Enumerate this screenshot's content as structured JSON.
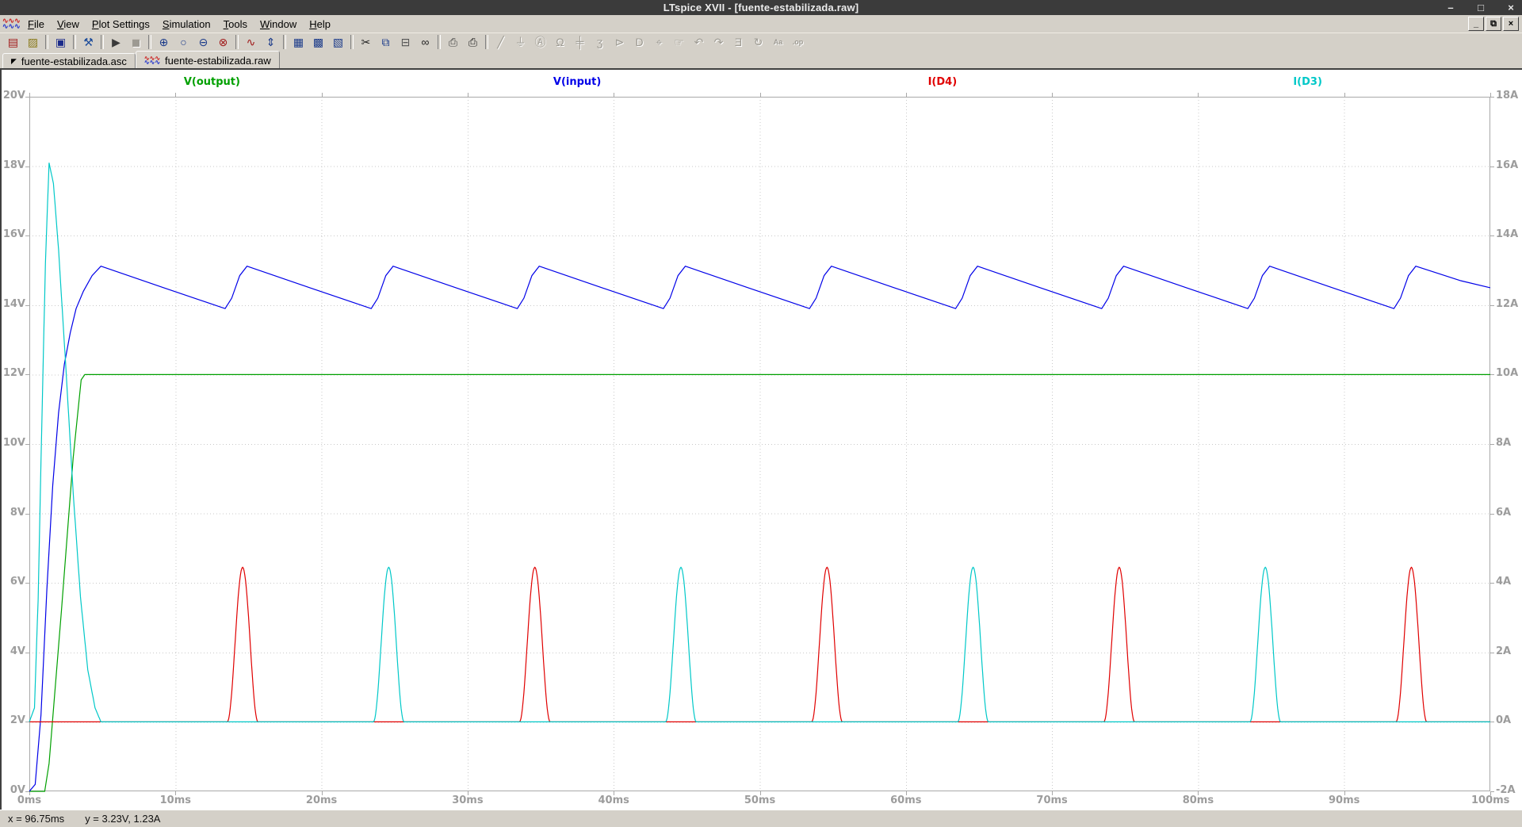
{
  "window": {
    "title": "LTspice XVII - [fuente-estabilizada.raw]",
    "controls": {
      "minimize": "–",
      "maximize": "□",
      "close": "×"
    }
  },
  "menubar": {
    "items": [
      {
        "label": "File"
      },
      {
        "label": "View"
      },
      {
        "label": "Plot Settings"
      },
      {
        "label": "Simulation"
      },
      {
        "label": "Tools"
      },
      {
        "label": "Window"
      },
      {
        "label": "Help"
      }
    ],
    "mdi_controls": {
      "minimize": "_",
      "restore": "⧉",
      "close": "×"
    },
    "app_icon_waves": {
      "top": "∿∿∿",
      "bottom": "∿∿∿"
    }
  },
  "toolbar": {
    "items": [
      {
        "name": "new-schematic",
        "glyph": "▤",
        "color": "#a01818",
        "enabled": true
      },
      {
        "name": "open-file",
        "glyph": "▨",
        "color": "#8a7a1a",
        "enabled": true
      },
      {
        "sep": true
      },
      {
        "name": "save",
        "glyph": "▣",
        "color": "#1a2a8a",
        "enabled": true
      },
      {
        "sep": true
      },
      {
        "name": "control-panel",
        "glyph": "⚒",
        "color": "#1a4a9a",
        "enabled": true
      },
      {
        "sep": true
      },
      {
        "name": "run-simulation",
        "glyph": "▶",
        "color": "#3a3a3a",
        "enabled": true
      },
      {
        "name": "halt-simulation",
        "glyph": "◼",
        "color": "#888888",
        "enabled": false
      },
      {
        "sep": true
      },
      {
        "name": "zoom-in",
        "glyph": "⊕",
        "color": "#1a3a8a",
        "enabled": true
      },
      {
        "name": "zoom-back",
        "glyph": "○",
        "color": "#1a3a8a",
        "enabled": true
      },
      {
        "name": "zoom-out",
        "glyph": "⊖",
        "color": "#1a3a8a",
        "enabled": true
      },
      {
        "name": "zoom-full-extents",
        "glyph": "⊗",
        "color": "#a01818",
        "enabled": true
      },
      {
        "sep": true
      },
      {
        "name": "plot-settings",
        "glyph": "∿",
        "color": "#a01818",
        "enabled": true
      },
      {
        "name": "autorange-axes",
        "glyph": "⇕",
        "color": "#1a3a8a",
        "enabled": true
      },
      {
        "sep": true
      },
      {
        "name": "tile-vertically",
        "glyph": "▦",
        "color": "#1a3a8a",
        "enabled": true
      },
      {
        "name": "tile-horizontally",
        "glyph": "▩",
        "color": "#1a3a8a",
        "enabled": true
      },
      {
        "name": "cascade-windows",
        "glyph": "▧",
        "color": "#1a3a8a",
        "enabled": true
      },
      {
        "sep": true
      },
      {
        "name": "cut",
        "glyph": "✂",
        "color": "#222222",
        "enabled": true
      },
      {
        "name": "copy",
        "glyph": "⧉",
        "color": "#1a3a8a",
        "enabled": true
      },
      {
        "name": "paste",
        "glyph": "⊟",
        "color": "#555555",
        "enabled": true
      },
      {
        "name": "find",
        "glyph": "∞",
        "color": "#222222",
        "enabled": true
      },
      {
        "sep": true
      },
      {
        "name": "print-preview",
        "glyph": "⎙",
        "color": "#444444",
        "enabled": true
      },
      {
        "name": "print",
        "glyph": "⎙",
        "color": "#222222",
        "enabled": true
      },
      {
        "sep": true
      },
      {
        "name": "draw-wire",
        "glyph": "╱",
        "color": "#444444",
        "enabled": false
      },
      {
        "name": "place-ground",
        "glyph": "⏚",
        "color": "#444444",
        "enabled": false
      },
      {
        "name": "place-label",
        "glyph": "Ⓐ",
        "color": "#444444",
        "enabled": false
      },
      {
        "name": "place-resistor",
        "glyph": "Ω",
        "color": "#444444",
        "enabled": false
      },
      {
        "name": "place-capacitor",
        "glyph": "╪",
        "color": "#444444",
        "enabled": false
      },
      {
        "name": "place-inductor",
        "glyph": "ʒ",
        "color": "#444444",
        "enabled": false
      },
      {
        "name": "place-diode",
        "glyph": "⊳",
        "color": "#444444",
        "enabled": false
      },
      {
        "name": "place-component",
        "glyph": "D",
        "color": "#444444",
        "enabled": false
      },
      {
        "name": "move",
        "glyph": "⌖",
        "color": "#444444",
        "enabled": false
      },
      {
        "name": "drag",
        "glyph": "☞",
        "color": "#444444",
        "enabled": false
      },
      {
        "name": "undo",
        "glyph": "↶",
        "color": "#444444",
        "enabled": false
      },
      {
        "name": "redo",
        "glyph": "↷",
        "color": "#444444",
        "enabled": false
      },
      {
        "name": "mirror",
        "glyph": "Ǝ",
        "color": "#444444",
        "enabled": false
      },
      {
        "name": "rotate",
        "glyph": "↻",
        "color": "#444444",
        "enabled": false
      },
      {
        "name": "add-text",
        "glyph": "Aa",
        "color": "#444444",
        "enabled": false,
        "small": true
      },
      {
        "name": "spice-directive",
        "glyph": ".op",
        "color": "#444444",
        "enabled": false,
        "small": true
      }
    ]
  },
  "tabs": [
    {
      "label": "fuente-estabilizada.asc",
      "active": false
    },
    {
      "label": "fuente-estabilizada.raw",
      "active": true
    }
  ],
  "statusbar": {
    "x_readout": "x = 96.75ms",
    "y_readout": "y = 3.23V, 1.23A"
  },
  "chart_data": {
    "type": "line",
    "background": "#ffffff",
    "grid": true,
    "grid_color": "#c9c9c9",
    "axis_color": "#a8a8a8",
    "label_color": "#9c9c9c",
    "legend_position": "top-spread",
    "x": {
      "unit": "ms",
      "min": 0,
      "max": 100,
      "tick": 10,
      "tick_labels": [
        "0ms",
        "10ms",
        "20ms",
        "30ms",
        "40ms",
        "50ms",
        "60ms",
        "70ms",
        "80ms",
        "90ms",
        "100ms"
      ]
    },
    "y_left": {
      "unit": "V",
      "min": 0,
      "max": 20,
      "tick": 2,
      "tick_labels": [
        "20V",
        "18V",
        "16V",
        "14V",
        "12V",
        "10V",
        "8V",
        "6V",
        "4V",
        "2V",
        "0V"
      ]
    },
    "y_right": {
      "unit": "A",
      "min": -2,
      "max": 18,
      "tick": 2,
      "tick_labels": [
        "18A",
        "16A",
        "14A",
        "12A",
        "10A",
        "8A",
        "6A",
        "4A",
        "2A",
        "0A",
        "-2A"
      ]
    },
    "series": [
      {
        "name": "V(output)",
        "color": "#00a000",
        "axis": "y_left",
        "points": [
          [
            0,
            0
          ],
          [
            1.05,
            0
          ],
          [
            1.35,
            0.8
          ],
          [
            2.2,
            5.2
          ],
          [
            3.0,
            9.6
          ],
          [
            3.55,
            11.85
          ],
          [
            3.8,
            12
          ],
          [
            100,
            12
          ]
        ]
      },
      {
        "name": "V(input)",
        "color": "#0000e8",
        "axis": "y_left",
        "points": [
          [
            0,
            0
          ],
          [
            0.4,
            0.2
          ],
          [
            0.8,
            2.2
          ],
          [
            1.2,
            5.8
          ],
          [
            1.6,
            8.8
          ],
          [
            2,
            10.9
          ],
          [
            2.4,
            12.3
          ],
          [
            2.8,
            13.2
          ],
          [
            3.2,
            13.9
          ],
          [
            3.7,
            14.4
          ],
          [
            4.3,
            14.85
          ],
          [
            4.9,
            15.12
          ],
          [
            9.2,
            14.5
          ],
          [
            13.4,
            13.9
          ],
          [
            13.85,
            14.2
          ],
          [
            14.4,
            14.85
          ],
          [
            14.9,
            15.12
          ],
          [
            19.2,
            14.5
          ],
          [
            23.4,
            13.9
          ],
          [
            23.85,
            14.2
          ],
          [
            24.4,
            14.85
          ],
          [
            24.9,
            15.12
          ],
          [
            29.2,
            14.5
          ],
          [
            33.4,
            13.9
          ],
          [
            33.85,
            14.2
          ],
          [
            34.4,
            14.85
          ],
          [
            34.9,
            15.12
          ],
          [
            39.2,
            14.5
          ],
          [
            43.4,
            13.9
          ],
          [
            43.85,
            14.2
          ],
          [
            44.4,
            14.85
          ],
          [
            44.9,
            15.12
          ],
          [
            49.2,
            14.5
          ],
          [
            53.4,
            13.9
          ],
          [
            53.85,
            14.2
          ],
          [
            54.4,
            14.85
          ],
          [
            54.9,
            15.12
          ],
          [
            59.2,
            14.5
          ],
          [
            63.4,
            13.9
          ],
          [
            63.85,
            14.2
          ],
          [
            64.4,
            14.85
          ],
          [
            64.9,
            15.12
          ],
          [
            69.2,
            14.5
          ],
          [
            73.4,
            13.9
          ],
          [
            73.85,
            14.2
          ],
          [
            74.4,
            14.85
          ],
          [
            74.9,
            15.12
          ],
          [
            79.2,
            14.5
          ],
          [
            83.4,
            13.9
          ],
          [
            83.85,
            14.2
          ],
          [
            84.4,
            14.85
          ],
          [
            84.9,
            15.12
          ],
          [
            89.2,
            14.5
          ],
          [
            93.4,
            13.9
          ],
          [
            93.85,
            14.2
          ],
          [
            94.4,
            14.85
          ],
          [
            94.9,
            15.12
          ],
          [
            98,
            14.7
          ],
          [
            100,
            14.5
          ]
        ]
      },
      {
        "name": "I(D4)",
        "color": "#e00000",
        "axis": "y_right",
        "baseline": 0,
        "pulses": {
          "centers": [
            14.6,
            34.6,
            54.6,
            74.6,
            94.6
          ],
          "peak": 4.45,
          "half_width": 1.05
        }
      },
      {
        "name": "I(D3)",
        "color": "#00c8c8",
        "axis": "y_right",
        "baseline": 0,
        "startup_points": [
          [
            0,
            0
          ],
          [
            0.35,
            0.4
          ],
          [
            0.6,
            3.5
          ],
          [
            0.85,
            8.5
          ],
          [
            1.1,
            13.2
          ],
          [
            1.35,
            16.1
          ],
          [
            1.65,
            15.5
          ],
          [
            2,
            13.6
          ],
          [
            2.5,
            10.2
          ],
          [
            3,
            6.6
          ],
          [
            3.5,
            3.6
          ],
          [
            4,
            1.5
          ],
          [
            4.5,
            0.4
          ],
          [
            4.9,
            0
          ]
        ],
        "pulses": {
          "centers": [
            24.6,
            44.6,
            64.6,
            84.6
          ],
          "peak": 4.45,
          "half_width": 1.05
        }
      }
    ]
  }
}
